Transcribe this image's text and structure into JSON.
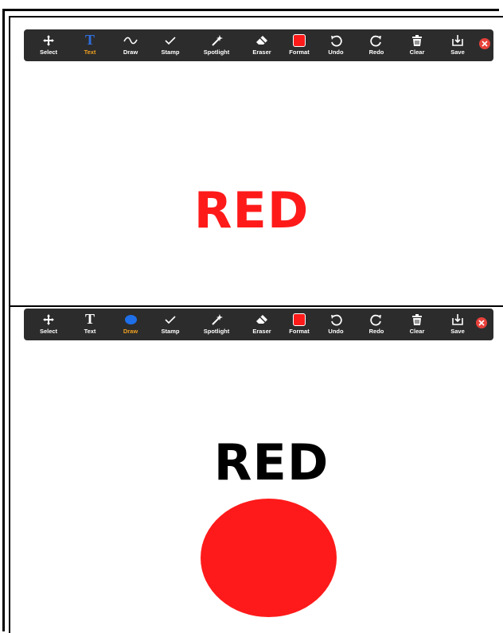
{
  "toolbar_top": {
    "tools": [
      {
        "label": "Select",
        "icon": "move-icon",
        "active": false
      },
      {
        "label": "Text",
        "icon": "text-icon",
        "active": true
      },
      {
        "label": "Draw",
        "icon": "squiggle-icon",
        "active": false
      },
      {
        "label": "Stamp",
        "icon": "checkmark-icon",
        "active": false
      },
      {
        "label": "Spotlight",
        "icon": "wand-icon",
        "active": false
      },
      {
        "label": "Eraser",
        "icon": "eraser-icon",
        "active": false
      },
      {
        "label": "Format",
        "icon": "color-swatch-icon",
        "active": false
      },
      {
        "label": "Undo",
        "icon": "undo-icon",
        "active": false
      },
      {
        "label": "Redo",
        "icon": "redo-icon",
        "active": false
      },
      {
        "label": "Clear",
        "icon": "trash-icon",
        "active": false
      },
      {
        "label": "Save",
        "icon": "save-icon",
        "active": false
      }
    ]
  },
  "toolbar_bottom": {
    "tools": [
      {
        "label": "Select",
        "icon": "move-icon",
        "active": false
      },
      {
        "label": "Text",
        "icon": "text-icon",
        "active": false
      },
      {
        "label": "Draw",
        "icon": "ellipse-icon",
        "active": true
      },
      {
        "label": "Stamp",
        "icon": "checkmark-icon",
        "active": false
      },
      {
        "label": "Spotlight",
        "icon": "wand-icon",
        "active": false
      },
      {
        "label": "Eraser",
        "icon": "eraser-icon",
        "active": false
      },
      {
        "label": "Format",
        "icon": "color-swatch-icon",
        "active": false
      },
      {
        "label": "Undo",
        "icon": "undo-icon",
        "active": false
      },
      {
        "label": "Redo",
        "icon": "redo-icon",
        "active": false
      },
      {
        "label": "Clear",
        "icon": "trash-icon",
        "active": false
      },
      {
        "label": "Save",
        "icon": "save-icon",
        "active": false
      }
    ]
  },
  "canvas_top": {
    "text": "RED",
    "color": "#ff1a1a"
  },
  "canvas_bottom": {
    "text": "RED",
    "color": "#000000",
    "shape_color": "#fe1a1a"
  },
  "colors": {
    "toolbar_bg": "#2c2c2c",
    "active_label": "#f0a020",
    "text_tool_active": "#2f6fe0",
    "draw_shape_blue": "#1e6fe8",
    "close_red": "#e8413b"
  }
}
